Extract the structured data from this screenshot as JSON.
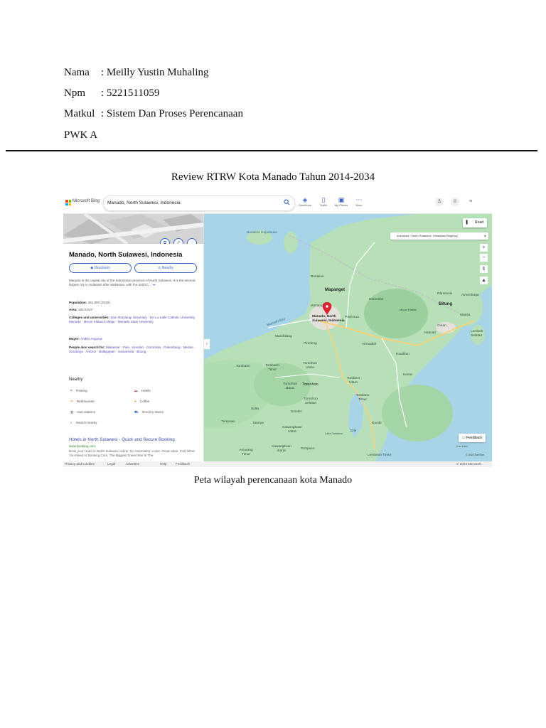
{
  "header": {
    "nama_label": "Nama",
    "nama_value": ": Meilly Yustin Muhaling",
    "npm_label": "Npm",
    "npm_value": ": 5221511059",
    "matkul_label": "Matkul",
    "matkul_value": ": Sistem Dan Proses Perencanaan",
    "class": "PWK A"
  },
  "title": "Review RTRW Kota Manado Tahun 2014-2034",
  "caption": "Peta wilayah perencanaan kota Manado",
  "screenshot": {
    "brand": "Microsoft Bing",
    "search_value": "Manado, North Sulawesi, Indonesia",
    "toolbar": [
      "Directions",
      "Traffic",
      "My Places",
      "More"
    ],
    "panel": {
      "place_title": "Manado, North Sulawesi, Indonesia",
      "directions_label": "Directions",
      "nearby_label": "Nearby",
      "description": "Manado is the capital city of the Indonesian province of North Sulawesi. It is the second largest city in Sulawesi after Makassar, with the 2020 C...",
      "population_label": "Population:",
      "population_value": "451,900 (2020)",
      "area_label": "Area:",
      "area_value": "162.5 km²",
      "colleges_label": "Colleges and universities:",
      "colleges_value": "Sam Ratulangi University · De La Salle Catholic University Manado · Mount Klabat College · Manado State University",
      "mayor_label": "Mayor:",
      "mayor_value": "Andrei Angouw",
      "also_label": "People also search for:",
      "also_value": "Makassar · Palu · Kendari · Gorontalo · Palembang · Medan · Surabaya · Ambon · Balikpapan · Samarinda · Bitung",
      "nearby_heading": "Nearby",
      "nearby_items": [
        "Parking",
        "Hotels",
        "Restaurants",
        "Coffee",
        "Gas stations",
        "Grocery stores",
        "Search nearby"
      ],
      "hotel_title": "Hotels in North Sulawesi - Quick and Secure Booking",
      "hotel_url": "www.booking.com",
      "hotel_desc": "Book your Hotel in North Sulawesi online. No reservation costs. Great rates. Find What You Need At Booking.Com, The Biggest Travel Site In The"
    },
    "map": {
      "road_label": "Road",
      "breadcrumb": "Indonesia › North Sulawesi › Minahasa Regency",
      "pin_label": "Manado, North Sulawesi, Indonesia",
      "feedback_label": "Feedback",
      "scale": "2 mi     5 km",
      "copyright_tomtom": "© 2023 TomTom",
      "labels": {
        "bunaken_kepulauan": "Bunaken Kepulauan",
        "bunaken": "Bunaken",
        "mapanget": "Mapanget",
        "wenang": "Wenang",
        "paal_dua": "Paal Dua",
        "dimembe": "Dimembe",
        "ranowulu": "Ranowulu",
        "airtembaga": "Airtembaga",
        "mount_klabat": "Mount Klabat",
        "bitung": "Bitung",
        "maesa": "Maesa",
        "girian": "Girian",
        "matuari": "Matuari",
        "lembeh_selatan": "Lembeh Selatan",
        "mandolang": "Mandolang",
        "pineleng": "Pineleng",
        "airmadidi": "Airmadidi",
        "kauditan": "Kauditan",
        "kema": "Kema",
        "tombariri": "Tombariri",
        "tombariri_timur": "Tombariri Timur",
        "tomohon_utara": "Tomohon Utara",
        "tomohon_barat": "Tomohon Barat",
        "tomohon": "Tomohon",
        "tondano_utara": "Tondano Utara",
        "tondano_timur": "Tondano Timur",
        "tomohon_selatan": "Tomohon Selatan",
        "sulta": "Sulta",
        "sonder": "Sonder",
        "kombi": "Kombi",
        "tumpaan": "Tumpaan",
        "tareran": "Tareran",
        "kawangkoan_utara": "Kawangkoan Utara",
        "lake_tondano": "Lake Tondano",
        "eris": "Eris",
        "amurang_timur": "Amurang Timur",
        "kawangkoan_barat": "Kawangkoan Barat",
        "tompaso": "Tompaso",
        "lembean_timur": "Lembean Timur",
        "manado_bay": "Manado Bay"
      }
    },
    "footer": [
      "Privacy and Cookies",
      "Legal",
      "Advertise",
      "Help",
      "Feedback"
    ],
    "footer_copyright": "© 2023 Microsoft",
    "colors": {
      "accent": "#3a63c8",
      "water": "#a7d5e7",
      "land": "#b7dfb8",
      "pin": "#d9262c"
    }
  }
}
